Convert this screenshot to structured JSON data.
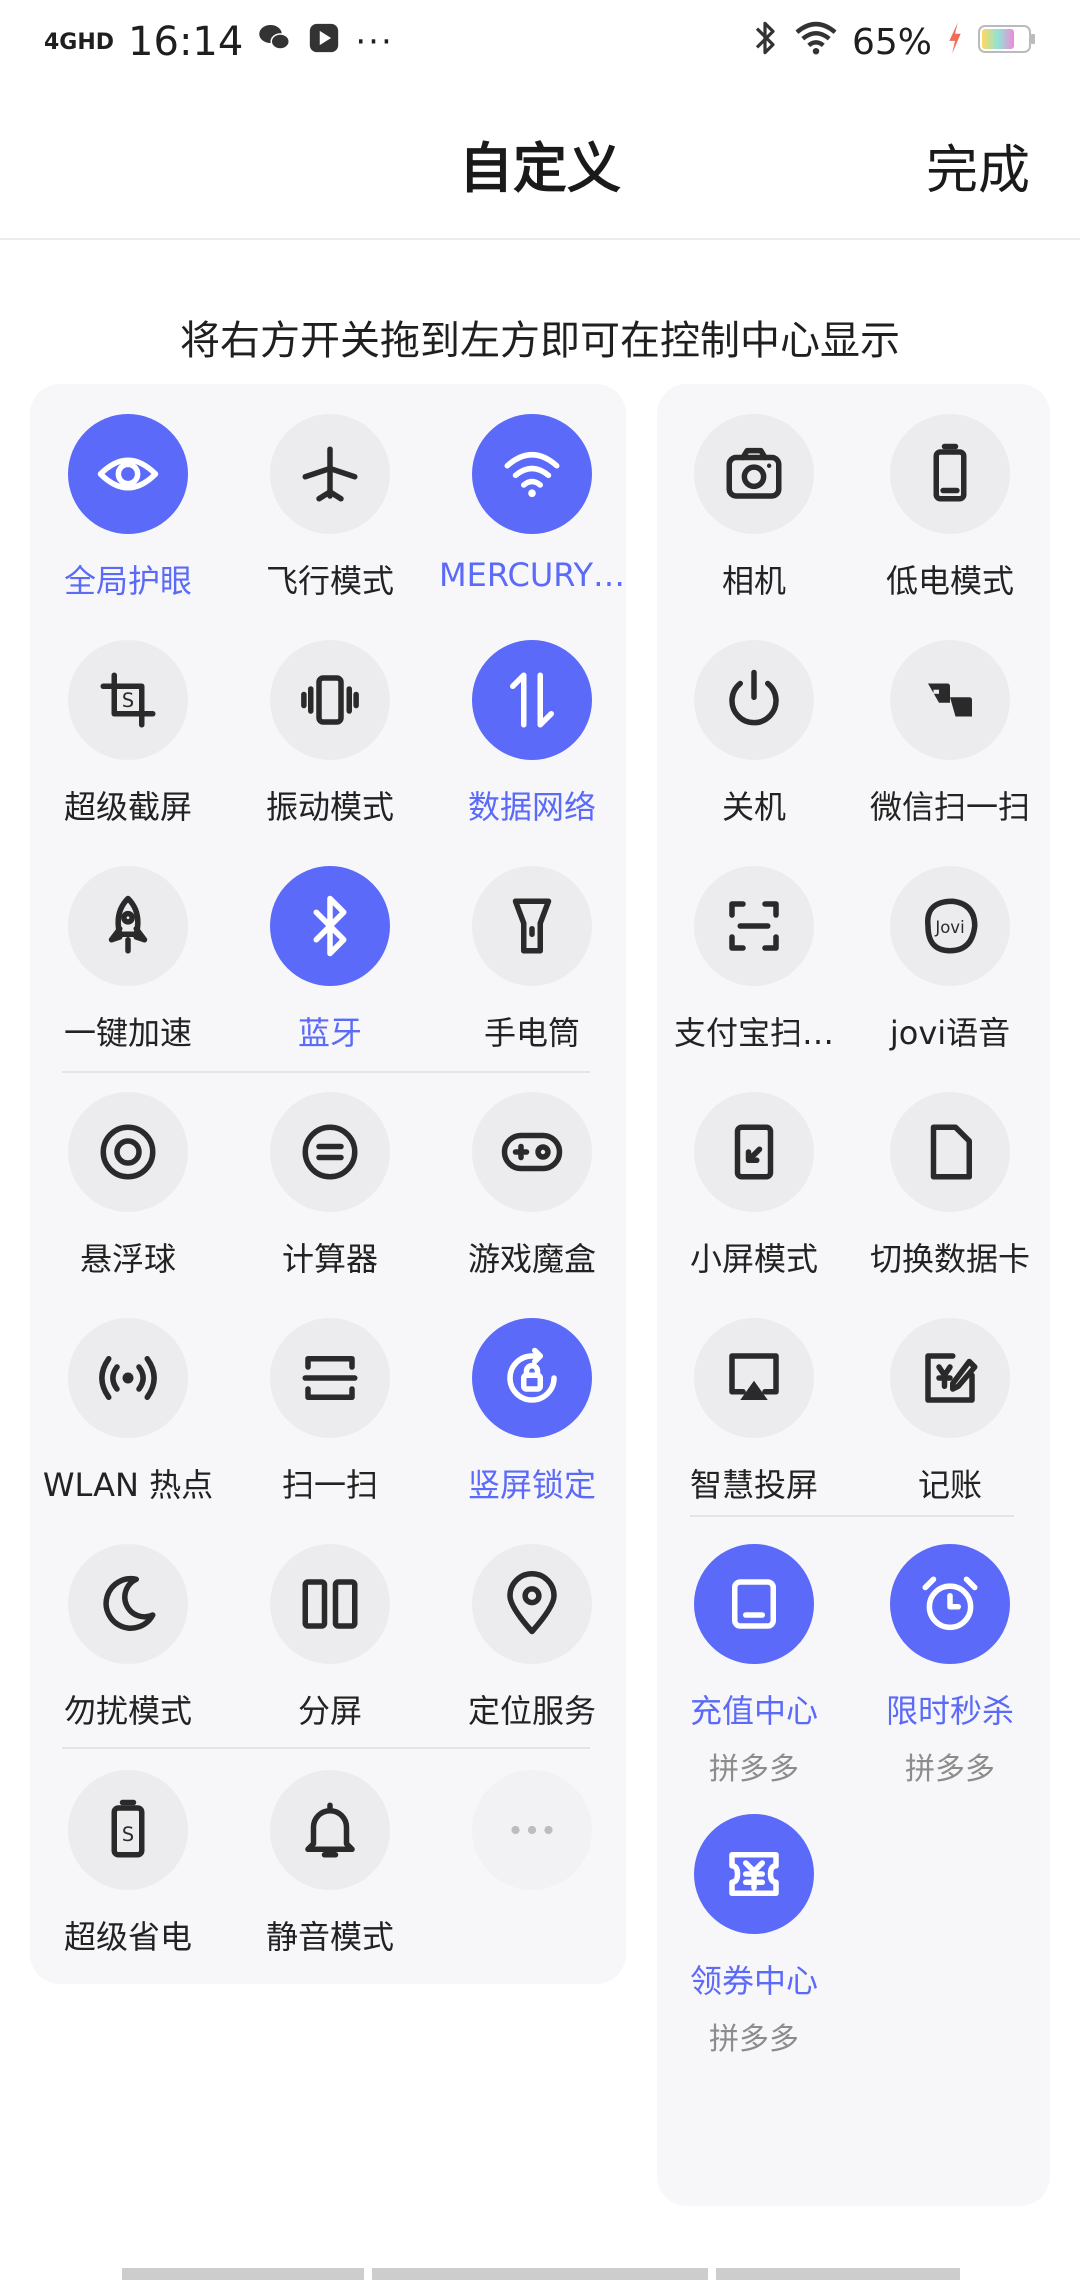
{
  "status_bar": {
    "network": "4GHD",
    "time": "16:14",
    "battery": "65%",
    "icons": [
      "wechat-icon",
      "media-icon",
      "more-icon",
      "bluetooth-icon",
      "wifi-icon",
      "charging-icon",
      "battery-icon"
    ]
  },
  "header": {
    "title": "自定义",
    "done_label": "完成"
  },
  "hint": "将右方开关拖到左方即可在控制中心显示",
  "accent_color": "#5b6af8",
  "left_panel": {
    "tiles": [
      {
        "label": "全局护眼",
        "icon": "eye-icon",
        "on": true
      },
      {
        "label": "飞行模式",
        "icon": "airplane-icon",
        "on": false
      },
      {
        "label": "MERCURY…",
        "icon": "wifi-icon",
        "on": true
      },
      {
        "label": "超级截屏",
        "icon": "crop-icon",
        "on": false
      },
      {
        "label": "振动模式",
        "icon": "vibrate-icon",
        "on": false
      },
      {
        "label": "数据网络",
        "icon": "data-icon",
        "on": true
      },
      {
        "label": "一键加速",
        "icon": "rocket-icon",
        "on": false
      },
      {
        "label": "蓝牙",
        "icon": "bluetooth-icon",
        "on": true
      },
      {
        "label": "手电筒",
        "icon": "flashlight-icon",
        "on": false
      },
      {
        "label": "悬浮球",
        "icon": "float-ball-icon",
        "on": false
      },
      {
        "label": "计算器",
        "icon": "calculator-icon",
        "on": false
      },
      {
        "label": "游戏魔盒",
        "icon": "gamepad-icon",
        "on": false
      },
      {
        "label": "WLAN 热点",
        "icon": "hotspot-icon",
        "on": false
      },
      {
        "label": "扫一扫",
        "icon": "scan-icon",
        "on": false
      },
      {
        "label": "竖屏锁定",
        "icon": "rotation-lock-icon",
        "on": true
      },
      {
        "label": "勿扰模式",
        "icon": "moon-icon",
        "on": false
      },
      {
        "label": "分屏",
        "icon": "split-screen-icon",
        "on": false
      },
      {
        "label": "定位服务",
        "icon": "location-icon",
        "on": false
      },
      {
        "label": "超级省电",
        "icon": "power-save-icon",
        "on": false
      },
      {
        "label": "静音模式",
        "icon": "bell-icon",
        "on": false
      }
    ],
    "more_icon": "more-icon"
  },
  "right_panel": {
    "tiles": [
      {
        "label": "相机",
        "icon": "camera-icon",
        "on": false
      },
      {
        "label": "低电模式",
        "icon": "low-battery-icon",
        "on": false
      },
      {
        "label": "关机",
        "icon": "power-icon",
        "on": false
      },
      {
        "label": "微信扫一扫",
        "icon": "wechat-scan-icon",
        "on": false
      },
      {
        "label": "支付宝扫…",
        "icon": "alipay-scan-icon",
        "on": false
      },
      {
        "label": "jovi语音",
        "icon": "jovi-icon",
        "on": false
      },
      {
        "label": "小屏模式",
        "icon": "small-screen-icon",
        "on": false
      },
      {
        "label": "切换数据卡",
        "icon": "sim-card-icon",
        "on": false
      },
      {
        "label": "智慧投屏",
        "icon": "cast-icon",
        "on": false
      },
      {
        "label": "记账",
        "icon": "bookkeeping-icon",
        "on": false
      },
      {
        "label": "充值中心",
        "sub": "拼多多",
        "icon": "recharge-icon",
        "on": true
      },
      {
        "label": "限时秒杀",
        "sub": "拼多多",
        "icon": "alarm-clock-icon",
        "on": true
      },
      {
        "label": "领券中心",
        "sub": "拼多多",
        "icon": "coupon-icon",
        "on": true
      }
    ]
  }
}
